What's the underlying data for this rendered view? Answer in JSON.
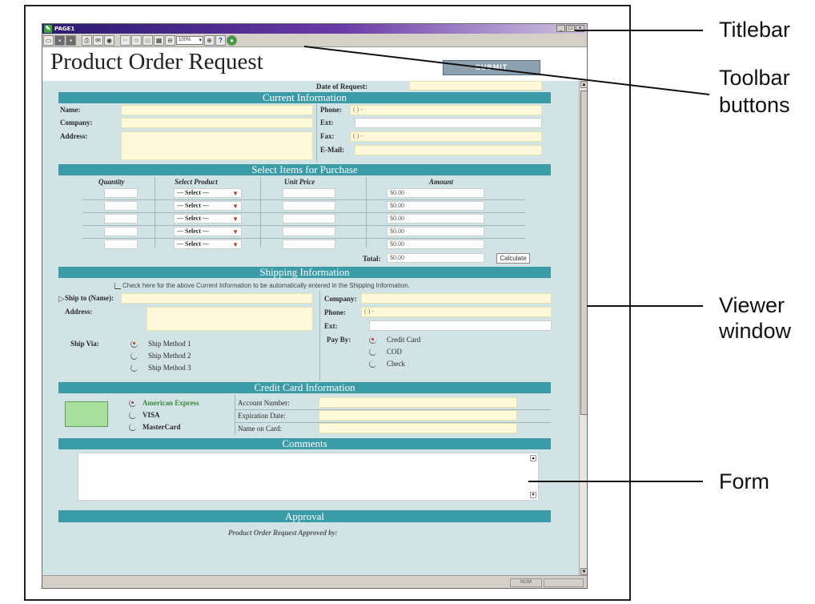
{
  "callouts": {
    "titlebar": "Titlebar",
    "toolbar_buttons_line1": "Toolbar",
    "toolbar_buttons_line2": "buttons",
    "viewer_window_line1": "Viewer",
    "viewer_window_line2": "window",
    "form": "Form"
  },
  "window": {
    "title": "PAGE1",
    "status_panel": "NUM"
  },
  "toolbar": {
    "zoom_value": "100%",
    "icons": [
      "open-icon",
      "save-icon",
      "save-as-icon",
      "print-icon",
      "email-icon",
      "preview-icon",
      "cut-icon",
      "copy-icon",
      "paste-icon",
      "table-icon",
      "zoom-out-icon",
      "zoom-in-icon",
      "help-icon",
      "exit-icon"
    ]
  },
  "header": {
    "title": "Product Order Request",
    "submit_label": "SUBMIT"
  },
  "form": {
    "date_label": "Date of Request:",
    "current_info": {
      "heading": "Current Information",
      "name_label": "Name:",
      "company_label": "Company:",
      "address_label": "Address:",
      "phone_label": "Phone:",
      "phone_value": "(   )   -",
      "ext_label": "Ext:",
      "fax_label": "Fax:",
      "fax_value": "(   )   -",
      "email_label": "E-Mail:"
    },
    "items": {
      "heading": "Select Items for Purchase",
      "columns": [
        "Quantity",
        "Select Product",
        "Unit Price",
        "Amount"
      ],
      "rows": [
        {
          "product": "--- Select ---",
          "amount": "$0.00"
        },
        {
          "product": "--- Select ---",
          "amount": "$0.00"
        },
        {
          "product": "--- Select ---",
          "amount": "$0.00"
        },
        {
          "product": "--- Select ---",
          "amount": "$0.00"
        },
        {
          "product": "--- Select ---",
          "amount": "$0.00"
        }
      ],
      "total_label": "Total:",
      "total_value": "$0.00",
      "calculate_label": "Calculate"
    },
    "shipping": {
      "heading": "Shipping Information",
      "copy_check_label": "Check here for the above Current Information to be automatically entered in the Shipping Information.",
      "ship_to_label": "Ship to (Name):",
      "address_label": "Address:",
      "company_label": "Company:",
      "phone_label": "Phone:",
      "phone_value": "(   )   -",
      "ext_label": "Ext:",
      "ship_via_label": "Ship Via:",
      "ship_methods": [
        "Ship Method 1",
        "Ship Method 2",
        "Ship Method 3"
      ],
      "pay_by_label": "Pay By:",
      "pay_options": [
        "Credit Card",
        "COD",
        "Check"
      ]
    },
    "credit_card": {
      "heading": "Credit Card Information",
      "card_types": [
        "American Express",
        "VISA",
        "MasterCard"
      ],
      "account_number_label": "Account Number:",
      "expiration_label": "Expiration Date:",
      "name_on_card_label": "Name on Card:"
    },
    "comments": {
      "heading": "Comments"
    },
    "approval": {
      "heading": "Approval",
      "approved_by_label": "Product Order Request Approved by:"
    }
  },
  "colors": {
    "section_bar": "#3b9ca8",
    "form_background": "#d2e3e5",
    "field_fill": "#fef9da",
    "accent_red": "#c0392b",
    "title_gradient_start": "#2a1a70"
  }
}
